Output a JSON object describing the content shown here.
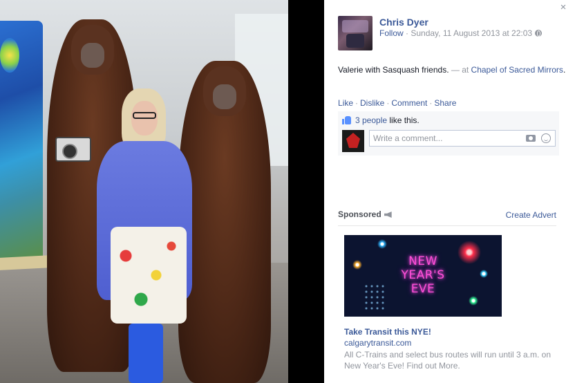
{
  "window": {
    "close_glyph": "×"
  },
  "post": {
    "author": "Chris Dyer",
    "follow_label": "Follow",
    "separator": " · ",
    "timestamp": "Sunday, 11 August 2013 at 22:03",
    "privacy_icon": "globe-icon",
    "status_prefix": "Valerie with Sasquash friends.",
    "status_dash": " — at ",
    "location": "Chapel of Sacred Mirrors",
    "status_suffix": "."
  },
  "actions": {
    "like": "Like",
    "dislike": "Dislike",
    "comment": "Comment",
    "share": "Share",
    "dot": "·"
  },
  "ufi": {
    "like_icon": "thumbs-up-icon",
    "people_count": "3 people",
    "like_suffix": " like this.",
    "comment_placeholder": "Write a comment..."
  },
  "sponsored": {
    "label": "Sponsored",
    "create_advert": "Create Advert",
    "ad": {
      "image_line1": "NEW",
      "image_line2": "YEAR'S",
      "image_line3": "EVE",
      "title": "Take Transit this NYE!",
      "domain": "calgarytransit.com",
      "body": "All C-Trains and select bus routes will run until 3 a.m. on New Year's Eve! Find out More."
    }
  },
  "colors": {
    "link": "#3b5998",
    "meta": "#90949c",
    "ufi_bg": "#f6f7f9",
    "divider": "#000000"
  }
}
